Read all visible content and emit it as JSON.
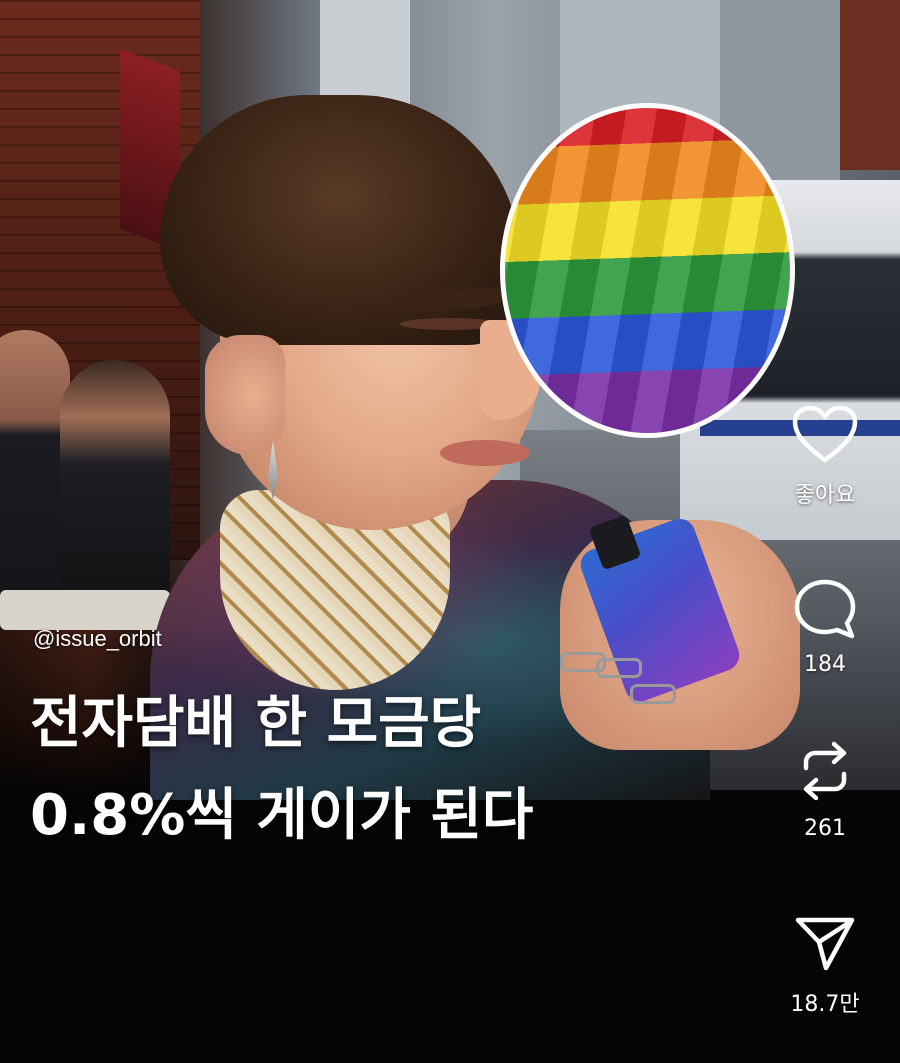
{
  "post": {
    "author_handle": "@issue_orbit",
    "headline_line1": "전자담배 한 모금당",
    "headline_line2": "0.8%씩 게이가 된다"
  },
  "actions": {
    "like": {
      "label": "좋아요",
      "icon": "heart-icon"
    },
    "comment": {
      "count": "184",
      "icon": "comment-bubble-icon"
    },
    "repost": {
      "count": "261",
      "icon": "repost-arrows-icon"
    },
    "share": {
      "count": "18.7만",
      "icon": "send-paper-plane-icon"
    }
  },
  "colors": {
    "background": "#050505",
    "text": "#ffffff",
    "rainbow": [
      "#d81f26",
      "#f18a1e",
      "#f5e025",
      "#2c9a3a",
      "#2b58d9",
      "#7a2fa8"
    ]
  }
}
